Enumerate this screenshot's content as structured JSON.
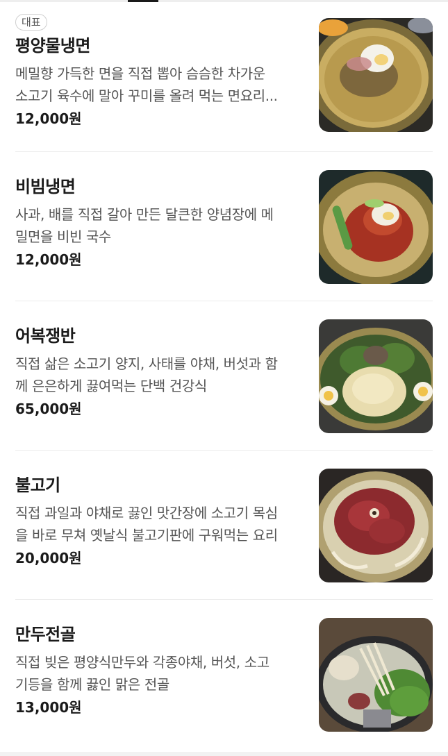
{
  "menu": {
    "items": [
      {
        "badge": "대표",
        "name": "평양물냉면",
        "desc_line1": "메밀향 가득한 면을 직접 뽑아 슴슴한 차가운",
        "desc_line2": "소고기 육수에 말아 꾸미를 올려 먹는 면요리...",
        "price": "12,000원",
        "image": "mul-naengmyeon-photo"
      },
      {
        "name": "비빔냉면",
        "desc_line1": "사과, 배를 직접 갈아 만든 달큰한 양념장에 메",
        "desc_line2": "밀면을 비빈 국수",
        "price": "12,000원",
        "image": "bibim-naengmyeon-photo"
      },
      {
        "name": "어복쟁반",
        "desc_line1": "직접 삶은 소고기 양지, 사태를 야채, 버섯과 함",
        "desc_line2": "께 은은하게 끓여먹는 단백 건강식",
        "price": "65,000원",
        "image": "eobok-jaengban-photo"
      },
      {
        "name": "불고기",
        "desc_line1": "직접 과일과 야채로 끓인 맛간장에 소고기 목심",
        "desc_line2": "을 바로 무쳐 옛날식 불고기판에 구워먹는 요리",
        "price": "20,000원",
        "image": "bulgogi-photo"
      },
      {
        "name": "만두전골",
        "desc_line1": "직접 빚은 평양식만두와 각종야채, 버섯, 소고",
        "desc_line2": "기등을 함께 끓인 맑은 전골",
        "price": "13,000원",
        "image": "mandu-jeongol-photo"
      }
    ]
  }
}
